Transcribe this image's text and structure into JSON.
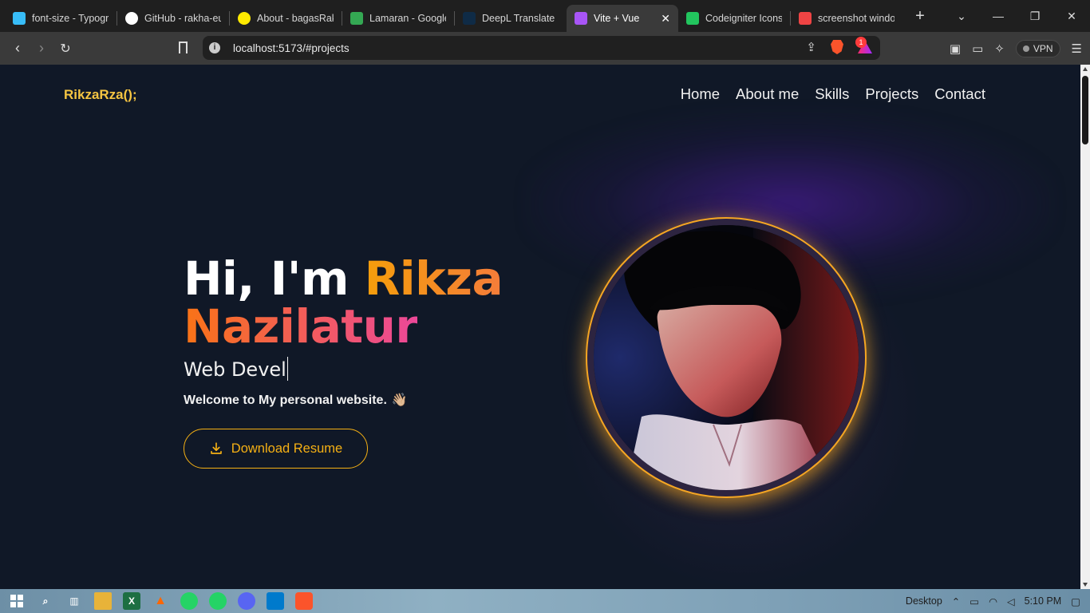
{
  "browser": {
    "tabs": [
      {
        "title": "font-size - Typography",
        "icon": "tailwind-icon",
        "color": "#38bdf8"
      },
      {
        "title": "GitHub - rakha-eureka",
        "icon": "github-icon",
        "color": "#ffffff"
      },
      {
        "title": "About - bagasRakha",
        "icon": "yellow-circle-icon",
        "color": "#ffea00"
      },
      {
        "title": "Lamaran - Google Drive",
        "icon": "google-drive-icon",
        "color": "#34a853"
      },
      {
        "title": "DeepL Translate",
        "icon": "deepl-icon",
        "color": "#0f2b46"
      },
      {
        "title": "Vite + Vue",
        "icon": "vite-icon",
        "color": "#a855f7",
        "active": true
      },
      {
        "title": "Codeigniter Icons",
        "icon": "codeigniter-icon",
        "color": "#22c55e"
      },
      {
        "title": "screenshot window",
        "icon": "brave-search-icon",
        "color": "#ef4444"
      }
    ],
    "new_tab": "+",
    "url": "localhost:5173/#projects",
    "shield_count": "1",
    "vpn_label": "VPN"
  },
  "page": {
    "logo": "RikzaRza();",
    "nav": [
      "Home",
      "About me",
      "Skills",
      "Projects",
      "Contact"
    ],
    "hero": {
      "greeting": "Hi, I'm ",
      "first_name": "Rikza",
      "last_name": "Nazilatur",
      "role_typed": "Web Devel",
      "welcome": "Welcome to My personal website.",
      "wave": "👋🏼",
      "download_label": "Download Resume"
    },
    "colors": {
      "background": "#101827",
      "accent": "#f5b014",
      "logo": "#f5c542"
    }
  },
  "taskbar": {
    "desktop_label": "Desktop",
    "time": "5:10 PM"
  }
}
